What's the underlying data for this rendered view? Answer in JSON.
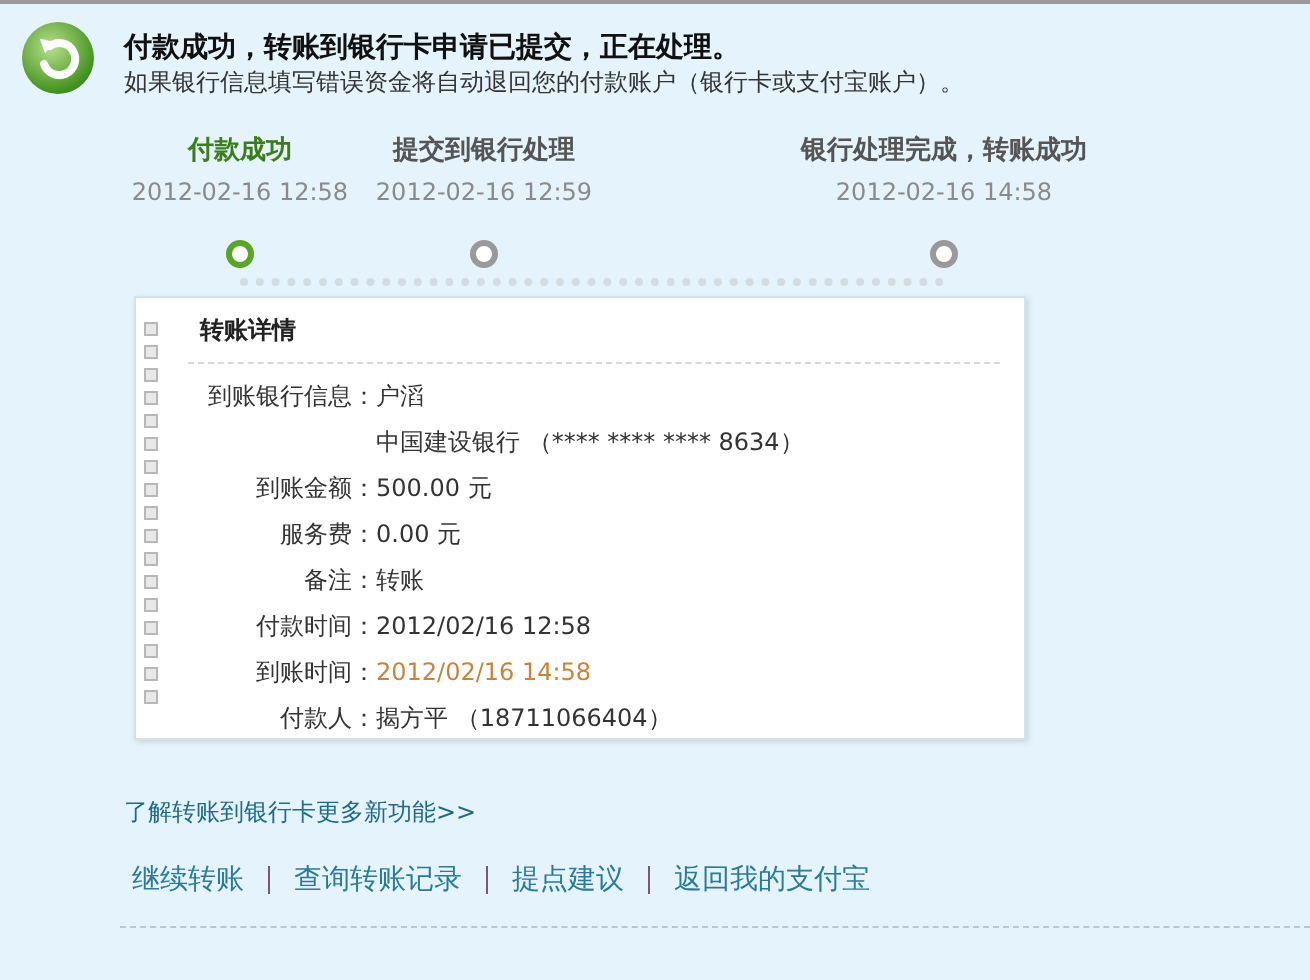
{
  "header": {
    "title": "付款成功，转账到银行卡申请已提交，正在处理。",
    "subtitle": "如果银行信息填写错误资金将自动退回您的付款账户（银行卡或支付宝账户）。"
  },
  "steps": [
    {
      "label": "付款成功",
      "time": "2012-02-16 12:58",
      "selected": true
    },
    {
      "label": "提交到银行处理",
      "time": "2012-02-16 12:59",
      "selected": false
    },
    {
      "label": "银行处理完成，转账成功",
      "time": "2012-02-16 14:58",
      "selected": false
    }
  ],
  "details": {
    "title": "转账详情",
    "rows": [
      {
        "label": "到账银行信息：",
        "value": "户滔",
        "highlight": false
      },
      {
        "value": "中国建设银行 （**** **** **** 8634）",
        "highlight": false
      },
      {
        "label": "到账金额：",
        "value": "500.00 元",
        "highlight": false
      },
      {
        "label": "服务费：",
        "value": "0.00 元",
        "highlight": false
      },
      {
        "label": "备注：",
        "value": "转账",
        "highlight": false
      },
      {
        "label": "付款时间：",
        "value": "2012/02/16 12:58",
        "highlight": false
      },
      {
        "label": "到账时间：",
        "value": "2012/02/16 14:58",
        "highlight": true
      },
      {
        "label": "付款人：",
        "value": "揭方平 （18711066404）",
        "highlight": false
      }
    ]
  },
  "more_link": "了解转账到银行卡更多新功能>>",
  "actions": [
    "继续转账",
    "查询转账记录",
    "提点建议",
    "返回我的支付宝"
  ]
}
